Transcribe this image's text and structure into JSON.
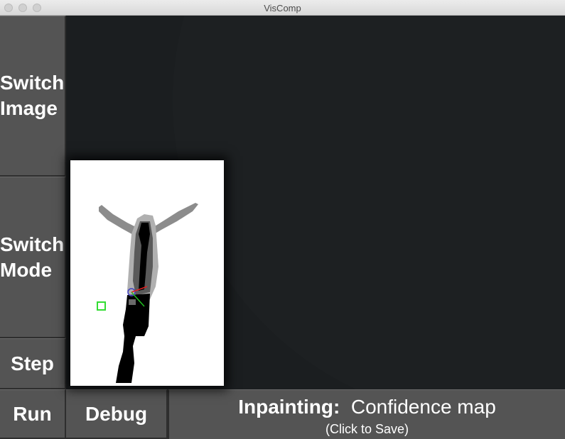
{
  "window": {
    "title": "VisComp"
  },
  "buttons": {
    "switch_image": "Switch\nImage",
    "switch_mode": "Switch\nMode",
    "step": "Step",
    "run": "Run",
    "debug": "Debug"
  },
  "status": {
    "label": "Inpainting:",
    "value": "Confidence map",
    "hint": "(Click to Save)"
  },
  "colors": {
    "button_bg": "#545454",
    "canvas_bg": "#1b1e20",
    "patch_outline": "#33dd33",
    "vector_red": "#e02020",
    "vector_green": "#20c020",
    "vector_blue": "#4040c0"
  }
}
